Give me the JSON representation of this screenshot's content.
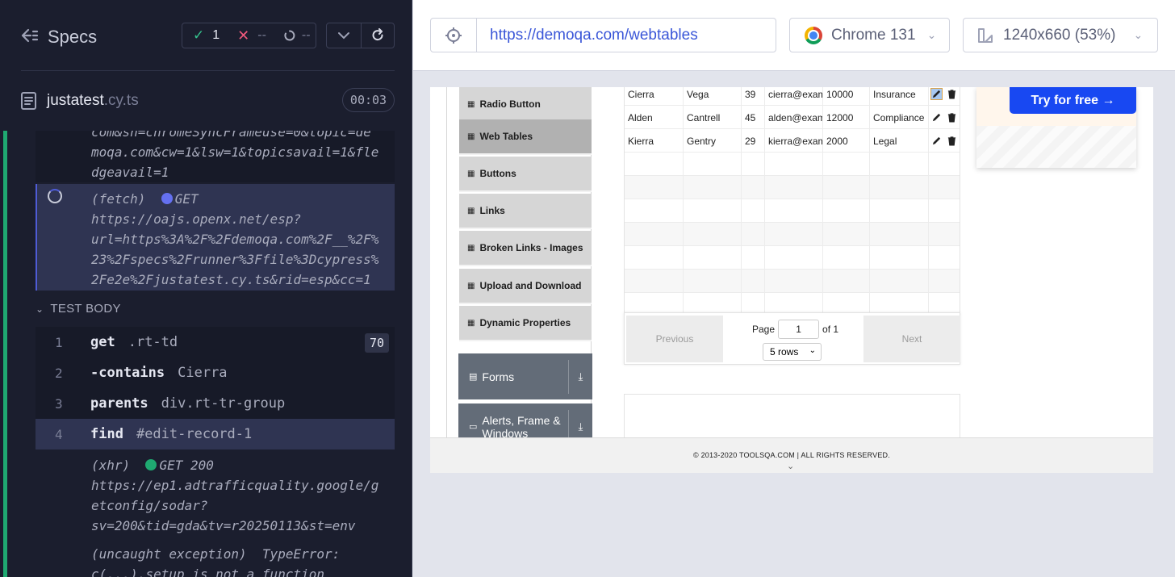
{
  "reporter": {
    "title": "Specs",
    "stats": {
      "passed": "1",
      "failed": "--",
      "pending": "--"
    },
    "spec": {
      "name": "justatest",
      "ext": ".cy.ts",
      "duration": "00:03"
    },
    "log_prev_lines": [
      "com&sh=chromeSyncFrameuse=0&topic=de",
      "moqa.com&cw=1&lsw=1&topicsavail=1&fle",
      "dgeavail=1"
    ],
    "fetch": {
      "type": "(fetch)",
      "method": "GET",
      "lines": [
        "https://oajs.openx.net/esp?",
        "url=https%3A%2F%2Fdemoqa.com%2F__%2F%",
        "23%2Fspecs%2Frunner%3Ffile%3Dcypress%",
        "2Fe2e%2Fjustatest.cy.ts&rid=esp&cc=1"
      ]
    },
    "section_title": "TEST BODY",
    "commands": [
      {
        "num": "1",
        "name": "get",
        "arg": ".rt-td",
        "badge": "70"
      },
      {
        "num": "2",
        "name": "-contains",
        "arg": "Cierra",
        "badge": ""
      },
      {
        "num": "3",
        "name": "parents",
        "arg": "div.rt-tr-group",
        "badge": ""
      },
      {
        "num": "4",
        "name": "find",
        "arg": "#edit-record-1",
        "badge": ""
      }
    ],
    "xhr": {
      "type": "(xhr)",
      "method": "GET 200",
      "lines": [
        "https://ep1.adtrafficquality.google/g",
        "etconfig/sodar?",
        "sv=200&tid=gda&tv=r20250113&st=env"
      ]
    },
    "exception": {
      "type": "(uncaught exception)",
      "message": "TypeError:",
      "line2": "c(...).setup is not a function"
    }
  },
  "aut": {
    "url": "https://demoqa.com/webtables",
    "browser": "Chrome 131",
    "viewport": "1240x660 (53%)",
    "menu_items": [
      "Radio Button",
      "Web Tables",
      "Buttons",
      "Links",
      "Broken Links - Images",
      "Upload and Download",
      "Dynamic Properties"
    ],
    "groups": [
      "Forms",
      "Alerts, Frame & Windows"
    ],
    "table_rows": [
      [
        "Cierra",
        "Vega",
        "39",
        "cierra@example.com",
        "10000",
        "Insurance"
      ],
      [
        "Alden",
        "Cantrell",
        "45",
        "alden@example.com",
        "12000",
        "Compliance"
      ],
      [
        "Kierra",
        "Gentry",
        "29",
        "kierra@example.com",
        "2000",
        "Legal"
      ]
    ],
    "pager": {
      "previous": "Previous",
      "next": "Next",
      "page_label": "Page",
      "page_value": "1",
      "of_label": "of 1",
      "rows": "5 rows"
    },
    "ad_button": "Try for free →",
    "footer": "© 2013-2020 TOOLSQA.COM | ALL RIGHTS RESERVED."
  },
  "colors": {
    "reporter_bg": "#1b1e2e",
    "pass_green": "#35c28d",
    "fail_pink": "#f0597c",
    "url_blue": "#3a56d8",
    "ad_blue": "#1848f2"
  }
}
